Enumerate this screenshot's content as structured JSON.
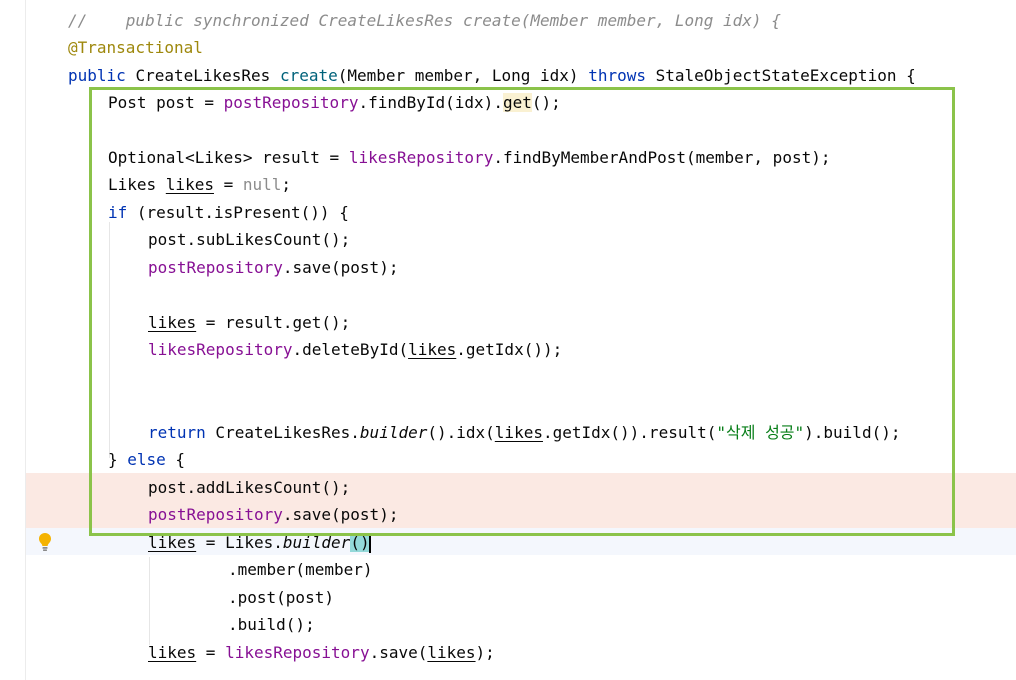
{
  "editor": {
    "intention_bulb_icon": "lightbulb-icon",
    "selection_color": "#8bc34a",
    "changed_line_color": "#fbe9e3",
    "lines": {
      "l1_comment": "//    public synchronized CreateLikesRes create(Member member, Long idx) {",
      "l2_annotation": "@Transactional",
      "l3": {
        "kw_public": "public",
        "type": "CreateLikesRes",
        "method": "create",
        "params": "(Member member, Long idx)",
        "kw_throws": "throws",
        "exception": "StaleObjectStateException {"
      },
      "l4": {
        "decl": "Post post = ",
        "field": "postRepository",
        "call": ".findById(idx).",
        "get": "get",
        "tail": "();"
      },
      "l6": {
        "decl": "Optional<Likes> result = ",
        "field": "likesRepository",
        "call": ".findByMemberAndPost(member, post);"
      },
      "l7": {
        "type": "Likes ",
        "var": "likes",
        "assign": " = ",
        "null": "null",
        "semi": ";"
      },
      "l8": {
        "kw_if": "if",
        "cond": " (result.isPresent()) {"
      },
      "l9": "post.subLikesCount();",
      "l10": {
        "field": "postRepository",
        "call": ".save(post);"
      },
      "l12": {
        "var": "likes",
        "rest": " = result.get();"
      },
      "l13": {
        "field": "likesRepository",
        "call": ".deleteById(",
        "var": "likes",
        "tail": ".getIdx());"
      },
      "l16": {
        "kw_return": "return",
        "type": " CreateLikesRes.",
        "builder": "builder",
        "mid": "().idx(",
        "var": "likes",
        "mid2": ".getIdx()).result(",
        "string": "\"삭제 성공\"",
        "tail": ").build();"
      },
      "l17": {
        "brace": "} ",
        "kw_else": "else",
        "open": " {"
      },
      "l18": "post.addLikesCount();",
      "l19": {
        "field": "postRepository",
        "call": ".save(post);"
      },
      "l20": {
        "var": "likes",
        "mid": " = Likes.",
        "builder": "builder",
        "open_paren": "(",
        "close_paren": ")"
      },
      "l21": ".member(member)",
      "l22": ".post(post)",
      "l23": ".build();",
      "l24": {
        "var": "likes",
        "mid": " = ",
        "field": "likesRepository",
        "call": ".save(",
        "var2": "likes",
        "tail": ");"
      }
    }
  }
}
